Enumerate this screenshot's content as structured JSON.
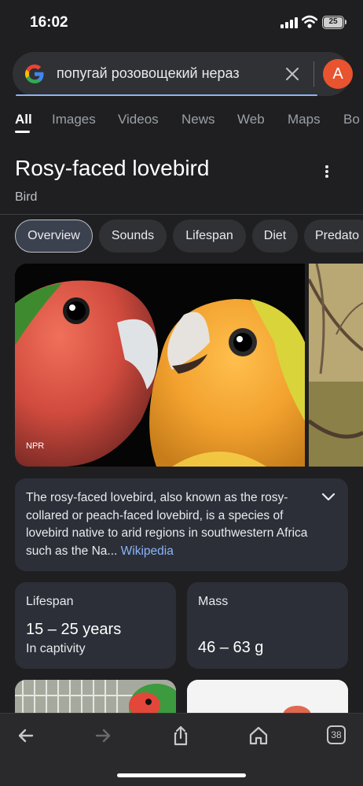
{
  "status": {
    "time": "16:02",
    "battery": "25"
  },
  "search": {
    "query": "попугай розовощекий нераз",
    "avatar_letter": "A"
  },
  "tabs": [
    "All",
    "Images",
    "Videos",
    "News",
    "Web",
    "Maps",
    "Bo"
  ],
  "entity": {
    "title": "Rosy-faced lovebird",
    "subtitle": "Bird"
  },
  "chips": [
    "Overview",
    "Sounds",
    "Lifespan",
    "Diet",
    "Predato"
  ],
  "photo": {
    "credit": "NPR"
  },
  "description": {
    "text": "The rosy-faced lovebird, also known as the rosy-collared or peach-faced lovebird, is a species of lovebird native to arid regions in southwestern Africa such as the Na",
    "ellipsis": "...",
    "link": "Wikipedia"
  },
  "facts": {
    "lifespan": {
      "label": "Lifespan",
      "value": "15 – 25 years",
      "note": "In captivity"
    },
    "mass": {
      "label": "Mass",
      "value": "46 – 63 g"
    }
  },
  "toolbar": {
    "tabs_count": "38"
  }
}
